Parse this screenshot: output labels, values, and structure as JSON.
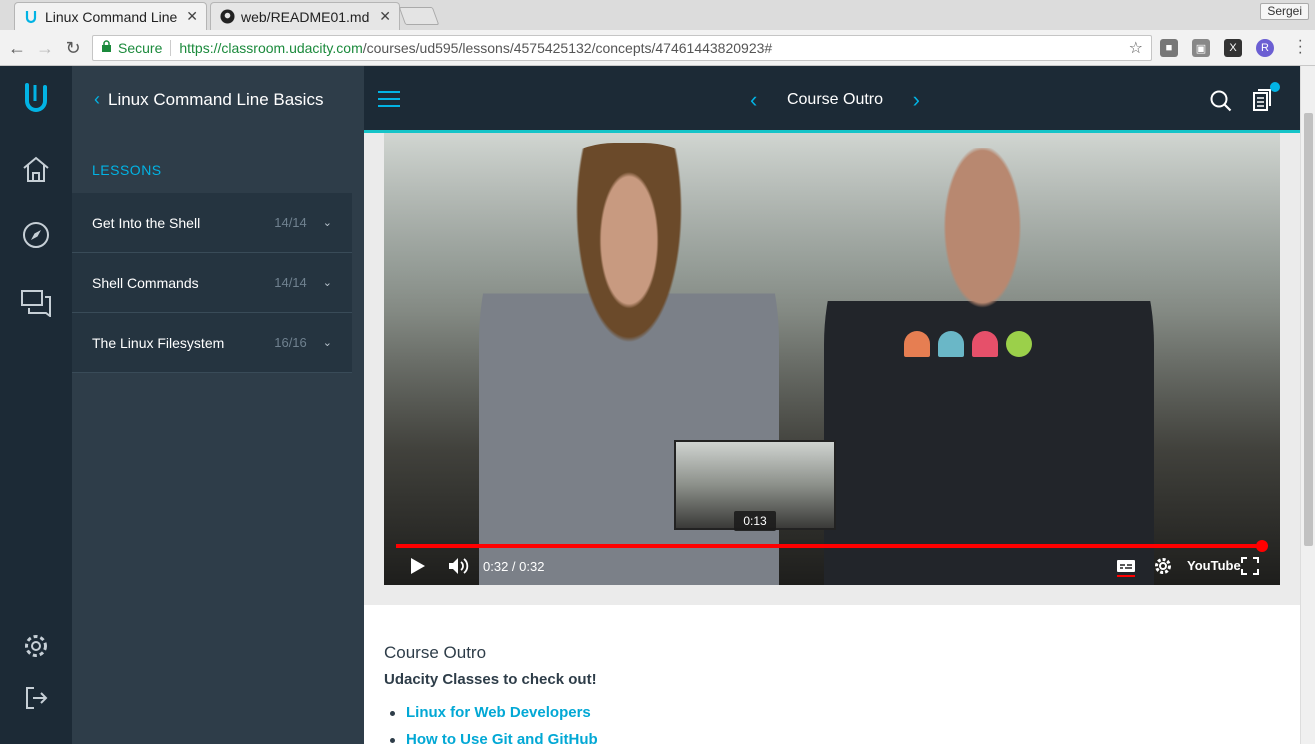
{
  "browser": {
    "tabs": [
      {
        "title": "Linux Command Line",
        "active": true,
        "icon": "udacity-icon"
      },
      {
        "title": "web/README01.md",
        "active": false,
        "icon": "github-icon"
      }
    ],
    "profile_name": "Sergei",
    "secure_label": "Secure",
    "url_scheme": "https://",
    "url_host": "classroom.udacity.com",
    "url_path": "/courses/ud595/lessons/4575425132/concepts/47461443820923#"
  },
  "sidebar": {
    "course_title": "Linux Command Line Basics",
    "lessons_label": "LESSONS",
    "lessons": [
      {
        "name": "Get Into the Shell",
        "progress": "14/14"
      },
      {
        "name": "Shell Commands",
        "progress": "14/14"
      },
      {
        "name": "The Linux Filesystem",
        "progress": "16/16"
      }
    ]
  },
  "topnav": {
    "concept_title": "Course Outro"
  },
  "video": {
    "current_time": "0:32",
    "duration": "0:32",
    "time_display": "0:32 / 0:32",
    "preview_time": "0:13",
    "progress_fraction": 1.0,
    "youtube_label": "YouTube"
  },
  "content": {
    "title": "Course Outro",
    "subtitle": "Udacity Classes to check out!",
    "links": [
      "Linux for Web Developers",
      "How to Use Git and GitHub"
    ]
  },
  "colors": {
    "accent": "#02b3e4",
    "rail_bg": "#1c2a36",
    "sidebar_bg": "#2e3d49",
    "progress": "#ff0000"
  }
}
